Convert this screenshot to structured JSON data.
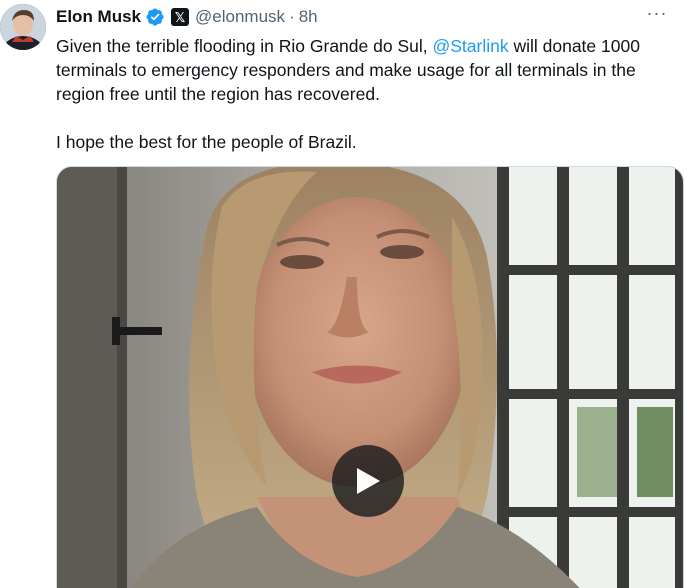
{
  "tweet": {
    "author_name": "Elon Musk",
    "handle": "@elonmusk",
    "separator": "·",
    "time": "8h",
    "more_label": "···",
    "text_before_mention": "Given the terrible flooding in Rio Grande do Sul, ",
    "mention": "@Starlink",
    "text_after_mention": " will donate 1000 terminals to emergency responders and make usage for all terminals in the region free until the region has recovered.",
    "paragraph_2": "I hope the best for the people of Brazil.",
    "x_badge": "𝕏"
  },
  "icons": {
    "verified": "verified-badge-icon",
    "play": "play-icon",
    "more": "more-icon"
  },
  "colors": {
    "text": "#0f1419",
    "secondary": "#536471",
    "link": "#1d9bf0",
    "verified": "#1d9bf0"
  }
}
